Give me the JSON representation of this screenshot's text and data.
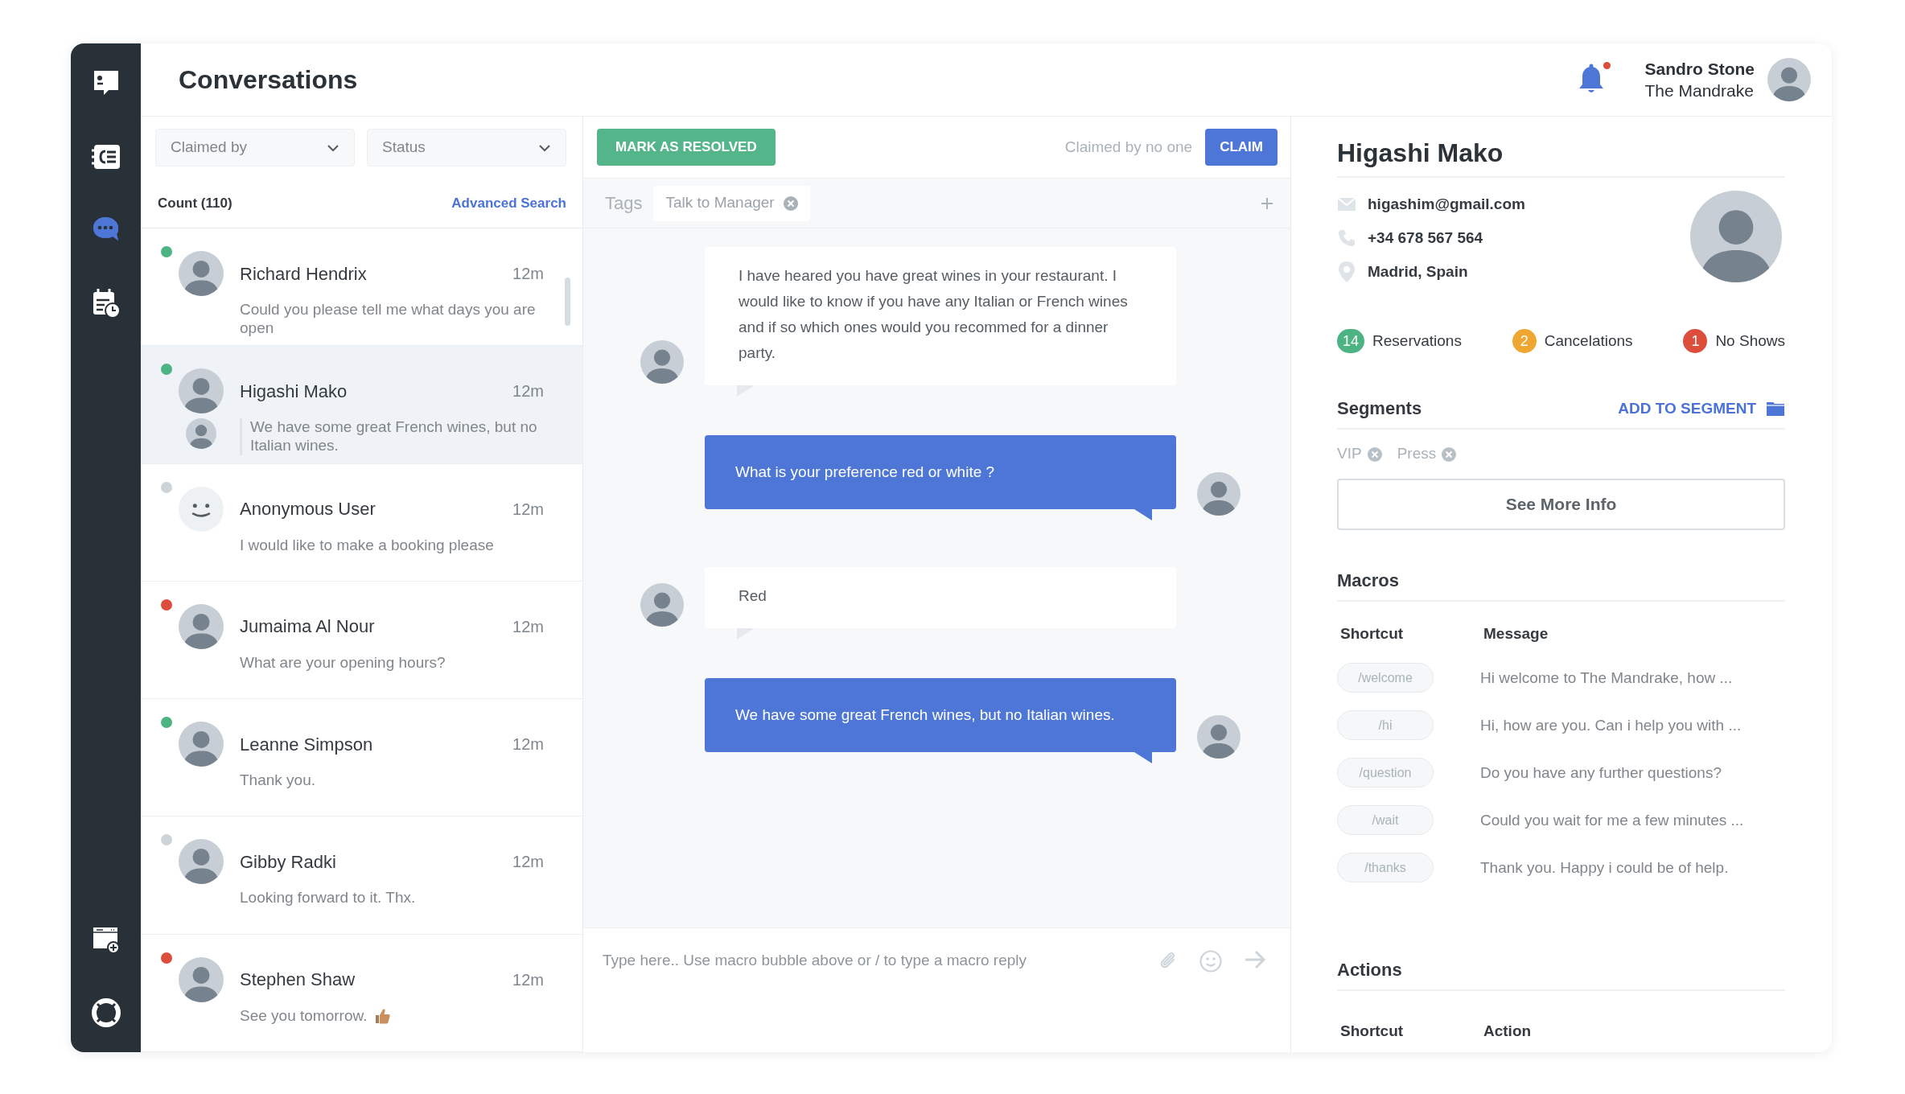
{
  "sidebar": {
    "top_items": [
      {
        "selected": false
      },
      {
        "selected": false
      },
      {
        "selected": true
      },
      {
        "selected": false
      }
    ],
    "bottom_items": [
      {
        "selected": false
      },
      {
        "selected": false
      }
    ]
  },
  "header": {
    "title": "Conversations",
    "has_unread": true,
    "user": {
      "name": "Sandro Stone",
      "venue": "The Mandrake"
    }
  },
  "filters": [
    {
      "label": "Claimed by"
    },
    {
      "label": "Status"
    }
  ],
  "count": "Count (110)",
  "advanced_search": "Advanced Search",
  "conversations": [
    {
      "kind": "contact",
      "name": "Richard Hendrix",
      "time": "12m",
      "preview": "Could you please tell me what days you are open",
      "color": "#4cb382",
      "selected": false,
      "agent_reply": false,
      "thumbs_up": false
    },
    {
      "kind": "contact",
      "name": "Higashi Mako",
      "time": "12m",
      "preview": "We have some great French wines, but no Italian wines.",
      "color": "#4cb382",
      "selected": true,
      "agent_reply": true,
      "thumbs_up": false
    },
    {
      "kind": "anonymous",
      "name": "Anonymous User",
      "time": "12m",
      "preview": "I would like to make a booking please",
      "color": "#cdd5db",
      "selected": false,
      "agent_reply": false,
      "thumbs_up": false
    },
    {
      "kind": "contact",
      "name": "Jumaima Al Nour",
      "time": "12m",
      "preview": "What are your opening hours?",
      "color": "#dc4d3b",
      "selected": false,
      "agent_reply": false,
      "thumbs_up": false
    },
    {
      "kind": "contact",
      "name": "Leanne Simpson",
      "time": "12m",
      "preview": "Thank you.",
      "color": "#4cb382",
      "selected": false,
      "agent_reply": false,
      "thumbs_up": false
    },
    {
      "kind": "contact",
      "name": "Gibby Radki",
      "time": "12m",
      "preview": "Looking forward to it. Thx.",
      "color": "#cdd5db",
      "selected": false,
      "agent_reply": false,
      "thumbs_up": false
    },
    {
      "kind": "contact",
      "name": "Stephen Shaw",
      "time": "12m",
      "preview": "See you tomorrow.",
      "color": "#dc4d3b",
      "selected": false,
      "agent_reply": false,
      "thumbs_up": true
    }
  ],
  "toolbar": {
    "resolve_button": "MARK AS RESOLVED",
    "claim_status": "Claimed by no one",
    "claim_button": "CLAIM"
  },
  "tags": {
    "label": "Tags",
    "items": [
      {
        "label": "Talk to Manager"
      }
    ]
  },
  "messages": [
    {
      "kind": "incoming",
      "text": "I have heared you have great wines in your restaurant. I would like to know if you have any Italian or French wines and if so which ones would you recommed for a dinner party."
    },
    {
      "kind": "outgoing",
      "text": "What is your preference red or white ?"
    },
    {
      "kind": "incoming",
      "text": "Red"
    },
    {
      "kind": "outgoing",
      "text": "We have some great French wines, but no Italian wines."
    }
  ],
  "composer": {
    "placeholder": "Type here.. Use macro bubble above or / to type a macro reply"
  },
  "contact": {
    "name": "Higashi Mako",
    "details": [
      {
        "kind": "email",
        "text": "higashim@gmail.com"
      },
      {
        "kind": "phone",
        "text": "+34 678 567 564"
      },
      {
        "kind": "location",
        "text": "Madrid, Spain"
      }
    ],
    "stats": [
      {
        "count": "14",
        "label": "Reservations",
        "color": "#4cb382"
      },
      {
        "count": "2",
        "label": "Cancelations",
        "color": "#f0a732"
      },
      {
        "count": "1",
        "label": "No Shows",
        "color": "#dc4d3b"
      }
    ]
  },
  "segments": {
    "title": "Segments",
    "add_link": "ADD TO SEGMENT",
    "items": [
      {
        "label": "VIP"
      },
      {
        "label": "Press"
      }
    ],
    "more_button": "See More Info"
  },
  "macros": {
    "title": "Macros",
    "columns": [
      "Shortcut",
      "Message"
    ],
    "rows": [
      {
        "shortcut": "/welcome",
        "message": "Hi welcome to The Mandrake, how ..."
      },
      {
        "shortcut": "/hi",
        "message": "Hi, how are you. Can i help you with ..."
      },
      {
        "shortcut": "/question",
        "message": "Do you have any further questions?"
      },
      {
        "shortcut": "/wait",
        "message": "Could you wait for me a few minutes ..."
      },
      {
        "shortcut": "/thanks",
        "message": "Thank you. Happy i could be of help."
      }
    ]
  },
  "actions": {
    "title": "Actions",
    "columns": [
      "Shortcut",
      "Action"
    ]
  }
}
